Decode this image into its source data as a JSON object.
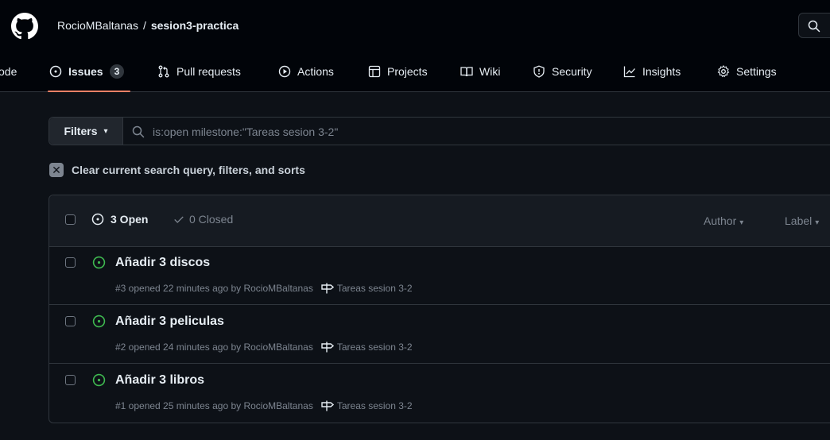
{
  "header": {
    "owner": "RocioMBaltanas",
    "separator": "/",
    "repo": "sesion3-practica"
  },
  "nav": {
    "code_partial": "ode",
    "issues": {
      "label": "Issues",
      "count": "3"
    },
    "pull_requests": "Pull requests",
    "actions": "Actions",
    "projects": "Projects",
    "wiki": "Wiki",
    "security": "Security",
    "insights": "Insights",
    "settings": "Settings"
  },
  "filters": {
    "button_label": "Filters",
    "query": "is:open milestone:\"Tareas sesion 3-2\""
  },
  "clear_label": "Clear current search query, filters, and sorts",
  "list_header": {
    "open_label": "3 Open",
    "closed_label": "0 Closed",
    "author_label": "Author",
    "label_label": "Label"
  },
  "issues": [
    {
      "title": "Añadir 3 discos",
      "meta": "#3 opened 22 minutes ago by RocioMBaltanas",
      "milestone": "Tareas sesion 3-2"
    },
    {
      "title": "Añadir 3 peliculas",
      "meta": "#2 opened 24 minutes ago by RocioMBaltanas",
      "milestone": "Tareas sesion 3-2"
    },
    {
      "title": "Añadir 3 libros",
      "meta": "#1 opened 25 minutes ago by RocioMBaltanas",
      "milestone": "Tareas sesion 3-2"
    }
  ],
  "colors": {
    "background": "#0d1117",
    "header_bg": "#010409",
    "border": "#30363d",
    "open_green": "#3fb950",
    "active_tab": "#f78166",
    "muted": "#7d8590"
  }
}
